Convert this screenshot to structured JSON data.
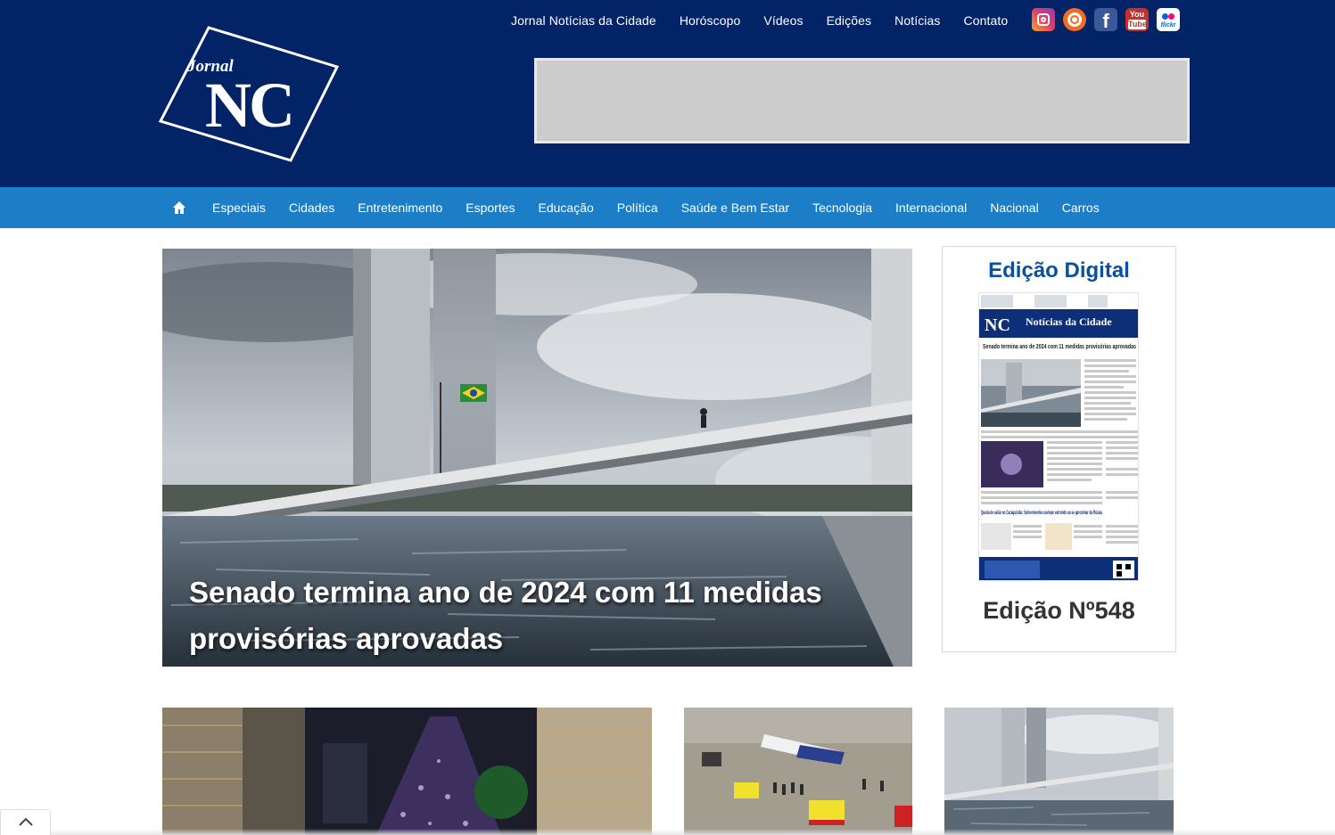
{
  "brand": {
    "logo_small": "Jornal",
    "logo_big": "NC",
    "header_bg": "#022366",
    "nav_bg": "#1b7ec6"
  },
  "topnav": [
    "Jornal Notícias da Cidade",
    "Horóscopo",
    "Vídeos",
    "Edições",
    "Notícias",
    "Contato"
  ],
  "social": [
    {
      "name": "instagram-icon"
    },
    {
      "name": "radio-icon"
    },
    {
      "name": "facebook-icon",
      "glyph": "f"
    },
    {
      "name": "youtube-icon",
      "top": "You",
      "bottom": "Tube"
    },
    {
      "name": "flickr-icon",
      "text": "flickr"
    }
  ],
  "catnav": [
    "Especiais",
    "Cidades",
    "Entretenimento",
    "Esportes",
    "Educação",
    "Política",
    "Saúde e Bem Estar",
    "Tecnologia",
    "Internacional",
    "Nacional",
    "Carros"
  ],
  "hero": {
    "title": "Senado termina ano de 2024 com 11 medidas provisórias aprovadas"
  },
  "edition": {
    "title": "Edição Digital",
    "number": "Edição Nº548",
    "cover": {
      "masthead": "Notícias da Cidade",
      "headline": "Senado termina ano de 2024 com 11 medidas provisórias aprovadas",
      "story2": "Queda de avião no Cazaquistão: Sobreviventes ouviram estrondo ao se aproximar da Rússia"
    }
  }
}
